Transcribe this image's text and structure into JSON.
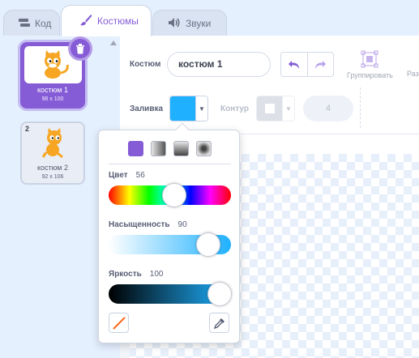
{
  "tabs": [
    {
      "label": "Код",
      "icon": "code-icon"
    },
    {
      "label": "Костюмы",
      "icon": "brush-icon"
    },
    {
      "label": "Звуки",
      "icon": "speaker-icon"
    }
  ],
  "costumes": [
    {
      "index": "1",
      "name": "костюм 1",
      "size": "96 x 100"
    },
    {
      "index": "2",
      "name": "костюм 2",
      "size": "92 x 106"
    }
  ],
  "editor": {
    "costume_label": "Костюм",
    "costume_name": "костюм 1",
    "group_label": "Группировать",
    "cut_label": "Раз",
    "fill_label": "Заливка",
    "outline_label": "Контур",
    "outline_width": "4",
    "fill_color": "#1fb1ff"
  },
  "color_picker": {
    "hue_label": "Цвет",
    "hue_value": "56",
    "saturation_label": "Насыщенность",
    "saturation_value": "90",
    "brightness_label": "Яркость",
    "brightness_value": "100"
  },
  "colors": {
    "accent": "#855cd6",
    "fill": "#1fb1ff",
    "background": "#e5f0ff"
  }
}
